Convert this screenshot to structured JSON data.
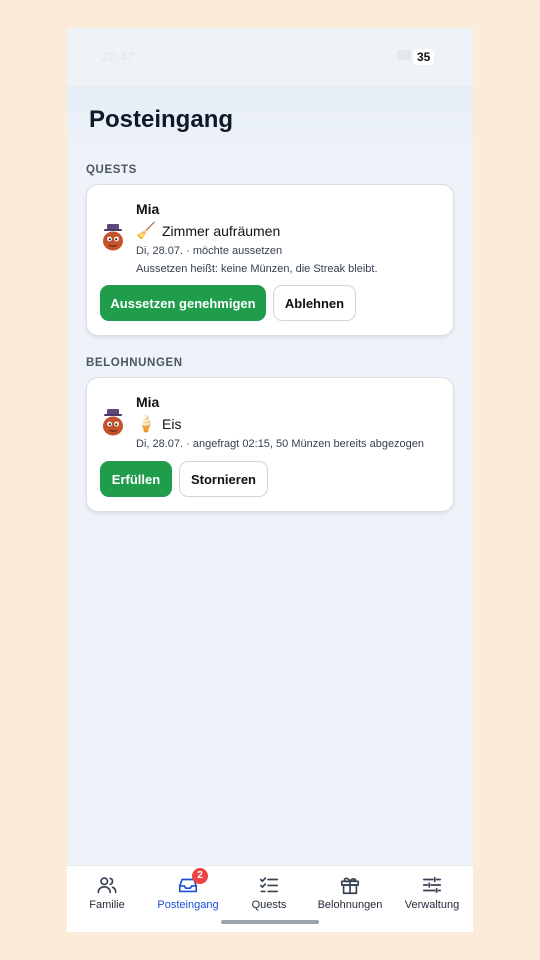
{
  "status_bar": {
    "time": "22:47",
    "battery": "35"
  },
  "page": {
    "title": "Posteingang"
  },
  "sections": {
    "quests": "QUESTS",
    "rewards": "BELOHNUNGEN"
  },
  "quest_card": {
    "name": "Mia",
    "item_emoji": "🧹",
    "item_title": "Zimmer aufräumen",
    "meta_line1": "Di, 28.07. · möchte aussetzen",
    "meta_line2": "Aussetzen heißt: keine Münzen, die Streak bleibt.",
    "primary_label": "Aussetzen genehmigen",
    "secondary_label": "Ablehnen"
  },
  "reward_card": {
    "name": "Mia",
    "item_emoji": "🍦",
    "item_title": "Eis",
    "meta_line1": "Di, 28.07. · angefragt 02:15, 50 Münzen bereits abgezogen",
    "primary_label": "Erfüllen",
    "secondary_label": "Stornieren"
  },
  "nav": {
    "items": [
      {
        "label": "Familie",
        "icon": "users-icon"
      },
      {
        "label": "Posteingang",
        "icon": "inbox-icon",
        "badge": "2",
        "active": true
      },
      {
        "label": "Quests",
        "icon": "checklist-icon"
      },
      {
        "label": "Belohnungen",
        "icon": "gift-icon"
      },
      {
        "label": "Verwaltung",
        "icon": "sliders-icon"
      }
    ]
  },
  "colors": {
    "primary": "#1f9d4a",
    "active_nav": "#1d4ed8",
    "badge": "#ef4444"
  }
}
